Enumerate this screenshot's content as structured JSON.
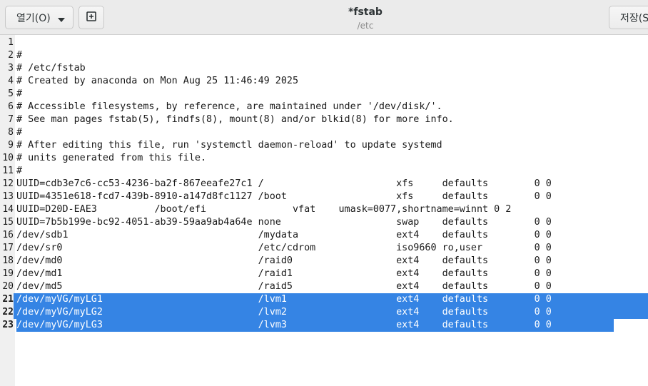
{
  "header": {
    "open_label": "열기(O)",
    "title": "*fstab",
    "subtitle": "/etc",
    "save_label": "저장(S)"
  },
  "icons": {
    "open_menu": "chevron-down-icon",
    "new_tab": "new-tab-icon"
  },
  "colors": {
    "selection": "#3584e4",
    "gutter": "#f0f0f0",
    "headerbar": "#ebebeb"
  },
  "editor": {
    "selected_lines": [
      21,
      22,
      23
    ],
    "lines": [
      {
        "num": "1",
        "text": ""
      },
      {
        "num": "2",
        "text": "#"
      },
      {
        "num": "3",
        "text": "# /etc/fstab"
      },
      {
        "num": "4",
        "text": "# Created by anaconda on Mon Aug 25 11:46:49 2025"
      },
      {
        "num": "5",
        "text": "#"
      },
      {
        "num": "6",
        "text": "# Accessible filesystems, by reference, are maintained under '/dev/disk/'."
      },
      {
        "num": "7",
        "text": "# See man pages fstab(5), findfs(8), mount(8) and/or blkid(8) for more info."
      },
      {
        "num": "8",
        "text": "#"
      },
      {
        "num": "9",
        "text": "# After editing this file, run 'systemctl daemon-reload' to update systemd"
      },
      {
        "num": "10",
        "text": "# units generated from this file."
      },
      {
        "num": "11",
        "text": "#"
      },
      {
        "num": "12",
        "text": "UUID=cdb3e7c6-cc53-4236-ba2f-867eeafe27c1 /                       xfs     defaults        0 0"
      },
      {
        "num": "13",
        "text": "UUID=4351e618-fcd7-439b-8910-a147d8fc1127 /boot                   xfs     defaults        0 0"
      },
      {
        "num": "14",
        "text": "UUID=D20D-EAE3          /boot/efi               vfat    umask=0077,shortname=winnt 0 2"
      },
      {
        "num": "15",
        "text": "UUID=7b5b199e-bc92-4051-ab39-59aa9ab4a64e none                    swap    defaults        0 0"
      },
      {
        "num": "16",
        "text": "/dev/sdb1                                 /mydata                 ext4    defaults        0 0"
      },
      {
        "num": "17",
        "text": "/dev/sr0                                  /etc/cdrom              iso9660 ro,user         0 0"
      },
      {
        "num": "18",
        "text": "/dev/md0                                  /raid0                  ext4    defaults        0 0"
      },
      {
        "num": "19",
        "text": "/dev/md1                                  /raid1                  ext4    defaults        0 0"
      },
      {
        "num": "20",
        "text": "/dev/md5                                  /raid5                  ext4    defaults        0 0"
      },
      {
        "num": "21",
        "text": "/dev/myVG/myLG1                           /lvm1                   ext4    defaults        0 0"
      },
      {
        "num": "22",
        "text": "/dev/myVG/myLG2                           /lvm2                   ext4    defaults        0 0"
      },
      {
        "num": "23",
        "text": "/dev/myVG/myLG3                           /lvm3                   ext4    defaults        0 0"
      }
    ]
  }
}
